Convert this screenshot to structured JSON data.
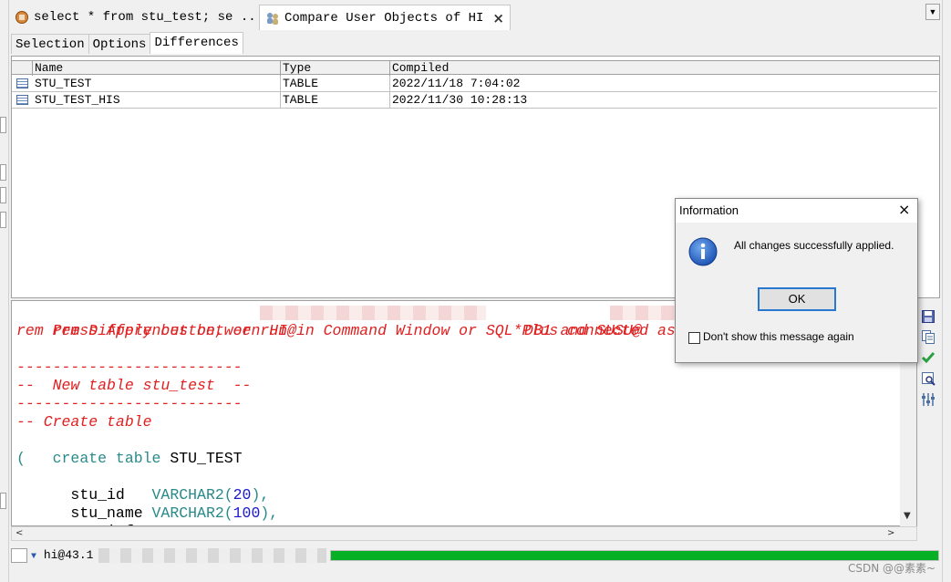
{
  "doc_tabs": [
    {
      "label": "select * from stu_test; se ...",
      "icon": "sql-window-icon"
    },
    {
      "label": "Compare User Objects of HI",
      "icon": "compare-users-icon",
      "close": "×"
    }
  ],
  "inner_tabs": [
    "Selection",
    "Options",
    "Differences"
  ],
  "grid": {
    "columns": [
      "Name",
      "Type",
      "Compiled"
    ],
    "rows": [
      {
        "name": "STU_TEST",
        "type": "TABLE",
        "compiled": "2022/11/18 7:04:02"
      },
      {
        "name": "STU_TEST_HIS",
        "type": "TABLE",
        "compiled": "2022/11/30 10:28:13"
      }
    ]
  },
  "editor": {
    "line1_a": "rem Differences between HI@",
    "line1_b": "DB1 and SUSU@",
    "line2": "rem Press Apply button, or run in Command Window or SQL*Plus connected as",
    "sep1": "-------------------------",
    "comment_new_table": "--  New table stu_test  --",
    "sep2": "-------------------------",
    "comment_create": "-- Create table",
    "create_kw": "create table",
    "create_name": " STU_TEST",
    "open_paren": "(",
    "col1_name": "  stu_id   ",
    "col1_type": "VARCHAR2(",
    "col1_len": "20",
    "col1_end": "),",
    "col2_name": "  stu_name ",
    "col2_type": "VARCHAR2(",
    "col2_len": "100",
    "col2_end": "),",
    "col3_name": "  stu_info ",
    "col3_type": "CLOB"
  },
  "status": {
    "connection": "hi@43.1",
    "progress": 1.0
  },
  "watermark": "CSDN @@素素~",
  "dialog": {
    "title": "Information",
    "close": "×",
    "message": "All changes successfully applied.",
    "ok_label": "OK",
    "checkbox_label": "Don't show this message again"
  },
  "colors": {
    "comment": "#e02020",
    "keyword": "#2a8a8a",
    "number": "#1a1acc",
    "progress": "#06b025",
    "focus": "#2878d0"
  }
}
